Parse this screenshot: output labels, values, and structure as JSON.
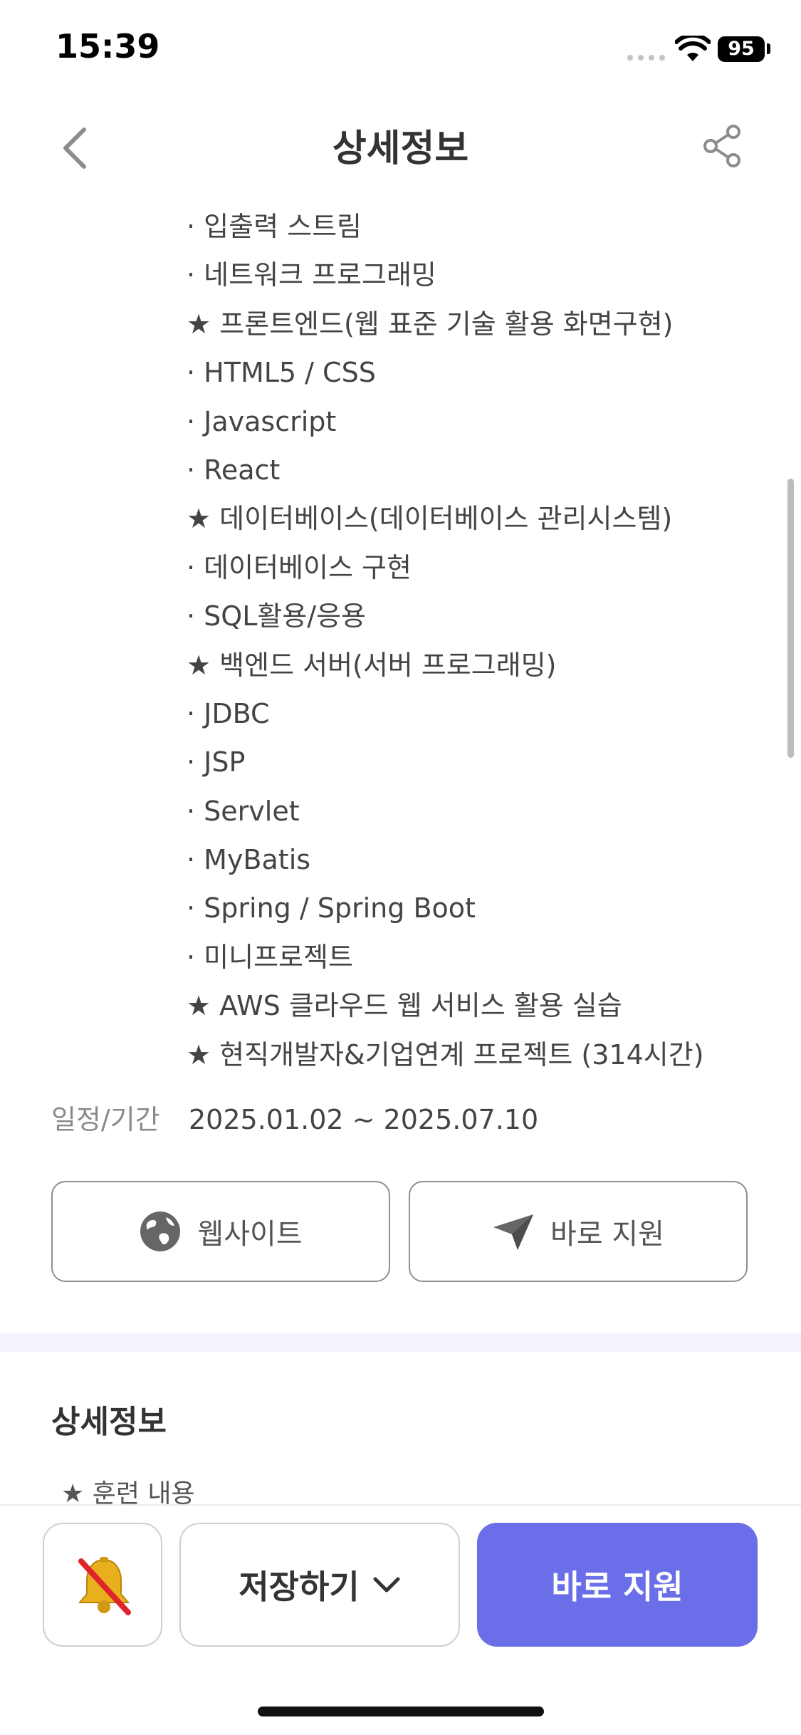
{
  "status_bar": {
    "time": "15:39",
    "battery": "95"
  },
  "header": {
    "title": "상세정보"
  },
  "curriculum": [
    "· 입출력 스트림",
    "· 네트워크 프로그래밍",
    "★ 프론트엔드(웹 표준 기술 활용 화면구현)",
    "· HTML5 / CSS",
    "· Javascript",
    "· React",
    "★ 데이터베이스(데이터베이스 관리시스템)",
    "· 데이터베이스 구현",
    "· SQL활용/응용",
    "★ 백엔드 서버(서버 프로그래밍)",
    "· JDBC",
    "· JSP",
    "· Servlet",
    "· MyBatis",
    "· Spring / Spring Boot",
    "· 미니프로젝트",
    "★ AWS 클라우드 웹 서비스 활용 실습",
    "★ 현직개발자&기업연계 프로젝트 (314시간)"
  ],
  "schedule": {
    "label": "일정/기간",
    "value": "2025.01.02 ~ 2025.07.10"
  },
  "actions": {
    "website_label": "웹사이트",
    "apply_label": "바로 지원"
  },
  "detail_section": {
    "title": "상세정보",
    "subtitle": "★ 훈련 내용"
  },
  "bottom_bar": {
    "save_label": "저장하기",
    "apply_label": "바로 지원"
  },
  "colors": {
    "accent": "#6a6ee8",
    "divider": "#f2f3fb"
  },
  "icons": [
    "back-icon",
    "share-icon",
    "globe-icon",
    "paper-plane-icon",
    "bell-off-icon",
    "chevron-down-icon",
    "wifi-icon"
  ]
}
